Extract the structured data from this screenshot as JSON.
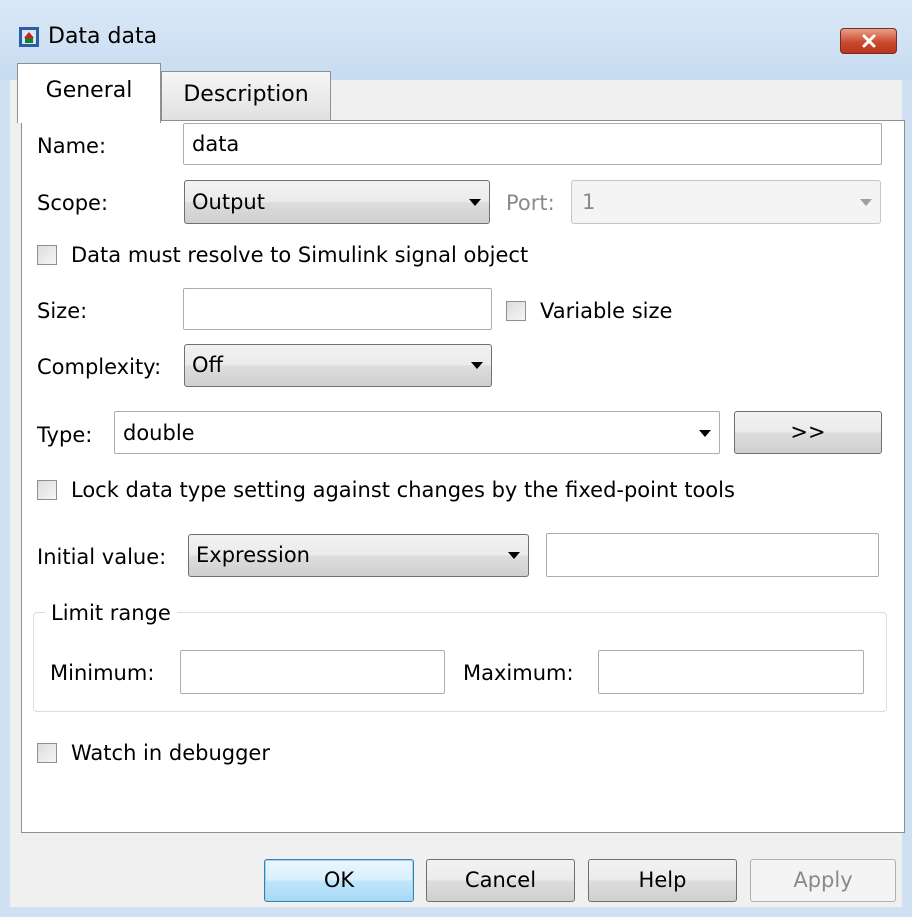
{
  "window": {
    "title": "Data data",
    "app_icon": "simulink-block-icon",
    "close_icon": "close-icon"
  },
  "tabs": [
    {
      "label": "General",
      "selected": true
    },
    {
      "label": "Description",
      "selected": false
    }
  ],
  "form": {
    "name": {
      "label": "Name:",
      "value": "data"
    },
    "scope": {
      "label": "Scope:",
      "value": "Output"
    },
    "port": {
      "label": "Port:",
      "value": "1",
      "disabled": true
    },
    "resolve_checkbox": {
      "label": "Data must resolve to Simulink signal object",
      "checked": false
    },
    "size": {
      "label": "Size:",
      "value": ""
    },
    "variable_size_checkbox": {
      "label": "Variable size",
      "checked": false
    },
    "complexity": {
      "label": "Complexity:",
      "value": "Off"
    },
    "type": {
      "label": "Type:",
      "value": "double",
      "assistant_button": ">>"
    },
    "lock_checkbox": {
      "label": "Lock data type setting against changes by the fixed-point tools",
      "checked": false
    },
    "initial_value": {
      "label": "Initial value:",
      "mode": "Expression",
      "value": ""
    },
    "limit_range": {
      "legend": "Limit range",
      "minimum": {
        "label": "Minimum:",
        "value": ""
      },
      "maximum": {
        "label": "Maximum:",
        "value": ""
      }
    },
    "watch_checkbox": {
      "label": "Watch in debugger",
      "checked": false
    }
  },
  "buttons": {
    "ok": "OK",
    "cancel": "Cancel",
    "help": "Help",
    "apply": "Apply"
  },
  "colors": {
    "title_bar": "#cfe0f3",
    "close_button": "#c94a2e",
    "default_button": "#3c7fb1"
  }
}
